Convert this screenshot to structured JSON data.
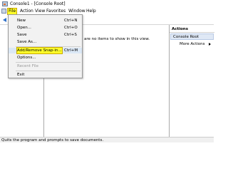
{
  "window": {
    "title": "Console1 - [Console Root]"
  },
  "menubar": {
    "items": [
      "File",
      "Action",
      "View",
      "Favorites",
      "Window",
      "Help"
    ],
    "active": "File"
  },
  "file_menu": {
    "new": {
      "label": "New",
      "shortcut": "Ctrl+N"
    },
    "open": {
      "label": "Open...",
      "shortcut": "Ctrl+O"
    },
    "save": {
      "label": "Save",
      "shortcut": "Ctrl+S"
    },
    "save_as": {
      "label": "Save As..."
    },
    "add_remove_snapin": {
      "label": "Add/Remove Snap-in...",
      "shortcut": "Ctrl+M"
    },
    "options": {
      "label": "Options..."
    },
    "recent_file": {
      "label": "Recent File"
    },
    "exit": {
      "label": "Exit"
    }
  },
  "result_pane": {
    "message": "are no items to show in this view."
  },
  "actions_pane": {
    "header": "Actions",
    "section": "Console Root",
    "more_actions": "More Actions"
  },
  "statusbar": {
    "text": "Quits the program and prompts to save documents."
  },
  "colors": {
    "highlight_yellow": "#ffff2a",
    "selection_blue": "#dbe8f6",
    "actions_section_bg": "#dfe8f5"
  }
}
